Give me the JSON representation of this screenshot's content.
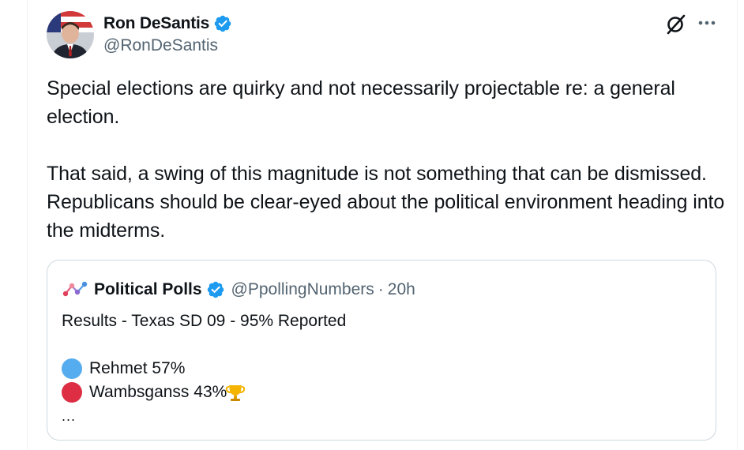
{
  "tweet": {
    "author_name": "Ron DeSantis",
    "author_handle": "@RonDeSantis",
    "paragraph_1": "Special elections are quirky and not necessarily projectable re: a general election.",
    "paragraph_2": "That said, a swing of this magnitude is not something that can be dismissed.  Republicans should be clear-eyed about the political environment heading into the midterms."
  },
  "quoted_tweet": {
    "author_name": "Political Polls",
    "author_handle": "@PpollingNumbers",
    "separator": "·",
    "time": "20h",
    "headline": "Results - Texas SD 09 - 95% Reported",
    "results": [
      {
        "label": "Rehmet 57%",
        "dot_color": "#55acee",
        "trophy": true
      },
      {
        "label": "Wambsganss 43%",
        "dot_color": "#dd2e44",
        "trophy": false
      }
    ],
    "truncation": "..."
  },
  "icons": {
    "verified": "verified-badge-icon",
    "grok": "grok-icon",
    "more": "more-options-icon"
  },
  "colors": {
    "verified_blue": "#1d9bf0",
    "secondary_text": "#536471",
    "quote_border": "#cfd9de"
  }
}
